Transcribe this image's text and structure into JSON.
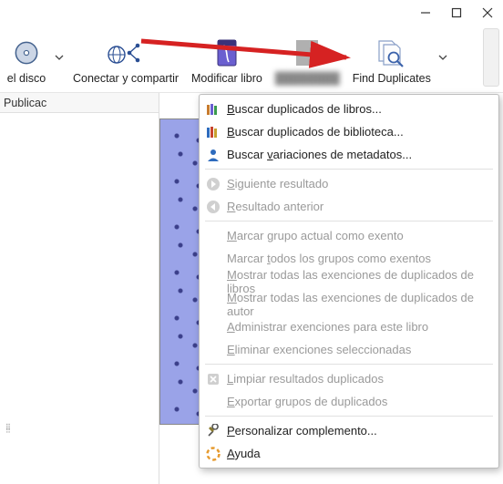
{
  "window": {
    "minimize": "Minimize",
    "maximize": "Maximize",
    "close": "Close"
  },
  "toolbar": {
    "disco": "el disco",
    "conectar": "Conectar y compartir",
    "modificar": "Modificar libro",
    "blurred": "",
    "find_dup": "Find Duplicates"
  },
  "columns": {
    "publicac": "Publicac"
  },
  "menu": {
    "buscar_libros": "Buscar duplicados de libros...",
    "buscar_biblio": "Buscar duplicados de biblioteca...",
    "buscar_var": "Buscar variaciones de metadatos...",
    "siguiente": "Siguiente resultado",
    "anterior": "Resultado anterior",
    "marcar_actual": "Marcar grupo actual como exento",
    "marcar_todos": "Marcar todos los grupos como exentos",
    "mostrar_libros": "Mostrar todas las exenciones de duplicados de libros",
    "mostrar_autor": "Mostrar todas las exenciones de duplicados de autor",
    "admin_exen": "Administrar exenciones para este libro",
    "eliminar_exen": "Eliminar exenciones seleccionadas",
    "limpiar": "Limpiar resultados duplicados",
    "exportar": "Exportar grupos de duplicados",
    "personalizar": "Personalizar complemento...",
    "ayuda": "Ayuda"
  }
}
